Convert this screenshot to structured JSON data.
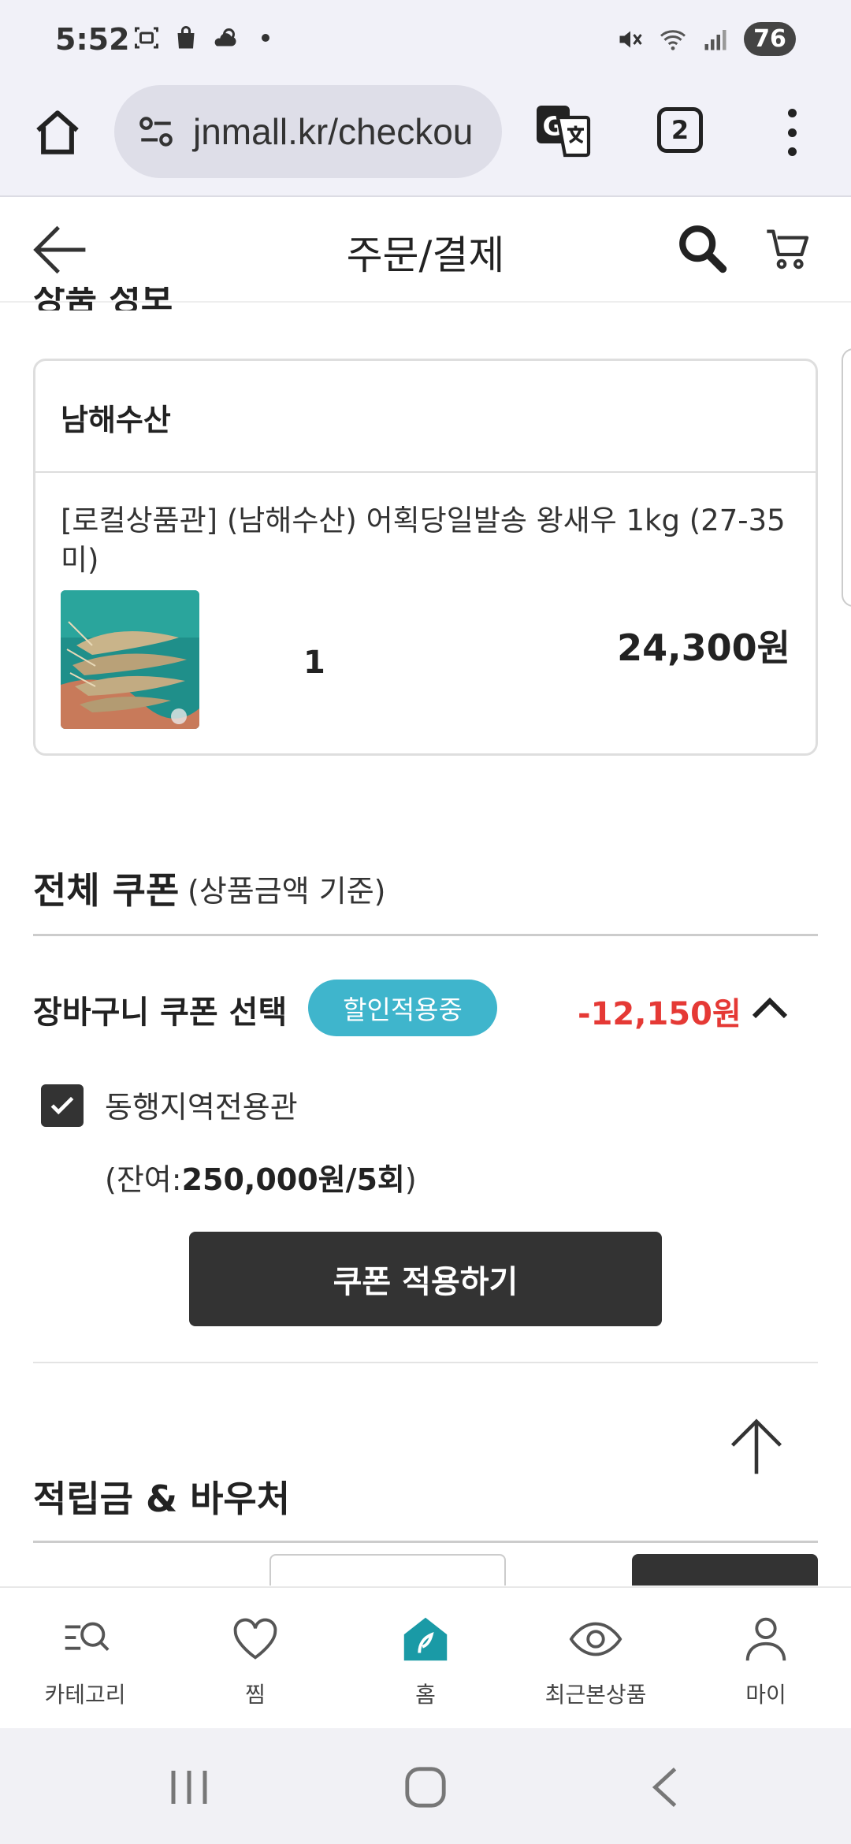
{
  "status_bar": {
    "time": "5:52",
    "battery": "76",
    "icons": [
      "screenshot-icon",
      "shopping-bag-icon",
      "weather-icon",
      "mute-icon",
      "wifi-icon",
      "signal-icon"
    ]
  },
  "browser": {
    "url": "jnmall.kr/checkou",
    "tab_count": "2",
    "icons": [
      "home-icon",
      "site-settings-icon",
      "translate-icon",
      "menu-icon"
    ]
  },
  "header": {
    "title": "주문/결제"
  },
  "product_section": {
    "title": "상품 정보",
    "seller": "남해수산",
    "product_name": "[로컬상품관] (남해수산) 어획당일발송 왕새우 1kg (27-35미)",
    "quantity": "1",
    "price": "24,300원"
  },
  "coupon_section": {
    "title": "전체 쿠폰",
    "subtitle": "(상품금액 기준)",
    "cart_coupon_label": "장바구니 쿠폰 선택",
    "applied_badge": "할인적용중",
    "discount": "-12,150원",
    "coupon_name": "동행지역전용관",
    "remain_prefix": "(잔여:",
    "remain_value": "250,000원/5회",
    "remain_suffix": ")",
    "apply_button": "쿠폰 적용하기"
  },
  "points_section": {
    "title": "적립금 & 바우처"
  },
  "bottom_nav": {
    "items": [
      {
        "label": "카테고리",
        "icon": "category-search-icon"
      },
      {
        "label": "찜",
        "icon": "heart-icon"
      },
      {
        "label": "홈",
        "icon": "home-leaf-icon"
      },
      {
        "label": "최근본상품",
        "icon": "eye-icon"
      },
      {
        "label": "마이",
        "icon": "person-icon"
      }
    ]
  },
  "colors": {
    "accent_teal": "#3fb5cc",
    "home_icon_teal": "#1a9aa6",
    "discount_red": "#e53935",
    "dark_button": "#333333"
  }
}
